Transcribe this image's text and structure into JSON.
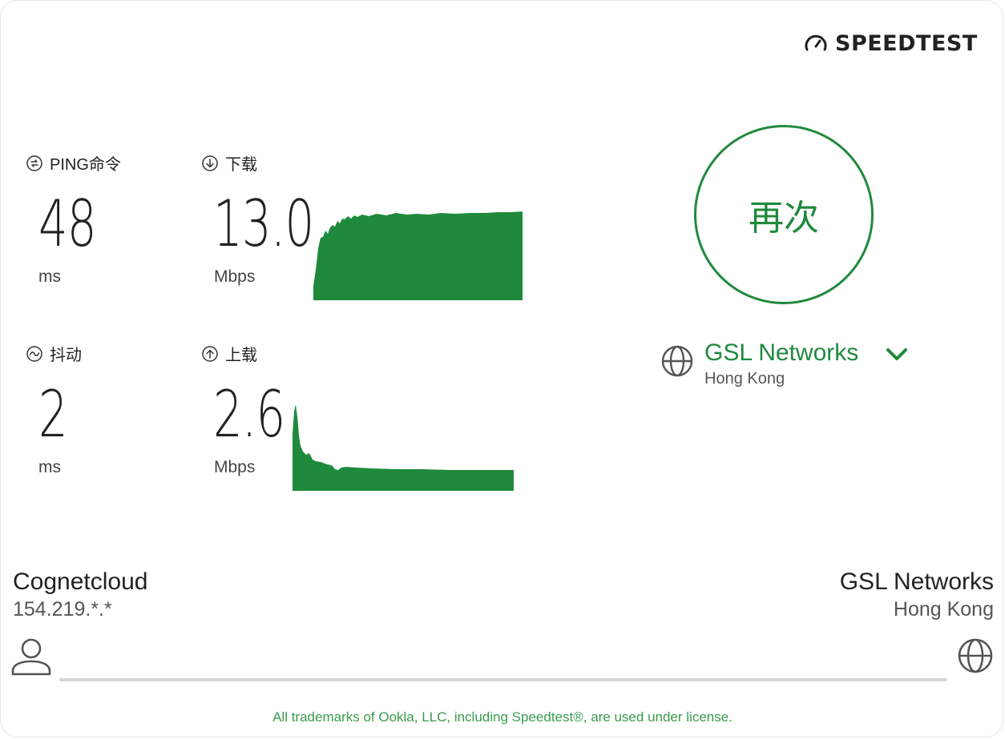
{
  "brand": {
    "logo_text": "SPEEDTEST"
  },
  "colors": {
    "accent": "#1f8a3c",
    "graph_fill": "#1f8a3c",
    "line": "#d6d6d6"
  },
  "metrics": {
    "ping": {
      "label": "PING命令",
      "value": "48",
      "unit": "ms",
      "icon": "ping-icon"
    },
    "download": {
      "label": "下载",
      "value": "13.0",
      "unit": "Mbps",
      "icon": "download-icon"
    },
    "jitter": {
      "label": "抖动",
      "value": "2",
      "unit": "ms",
      "icon": "jitter-icon"
    },
    "upload": {
      "label": "上载",
      "value": "2.6",
      "unit": "Mbps",
      "icon": "upload-icon"
    }
  },
  "again_button": {
    "label": "再次"
  },
  "server": {
    "name": "GSL Networks",
    "location": "Hong Kong"
  },
  "isp": {
    "name": "Cognetcloud",
    "ip": "154.219.*.*"
  },
  "host": {
    "name": "GSL Networks",
    "location": "Hong Kong"
  },
  "footer": {
    "text": "All trademarks of Ookla, LLC, including Speedtest®, are used under license."
  }
}
